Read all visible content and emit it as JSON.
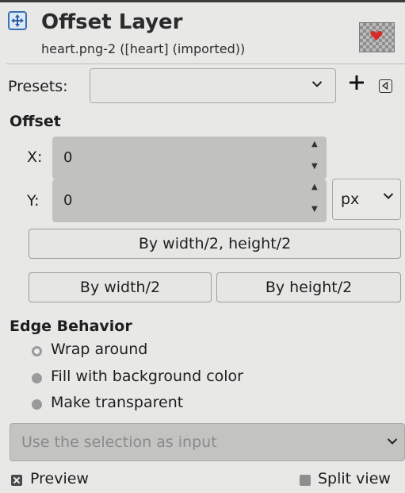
{
  "header": {
    "title": "Offset Layer",
    "subtitle": "heart.png-2 ([heart] (imported))",
    "icon": "move-icon",
    "thumbnail_icon": "heart-icon",
    "accent": "#d42a2a"
  },
  "presets": {
    "label": "Presets:",
    "value": "",
    "add_icon": "plus-icon",
    "menu_icon": "menu-icon"
  },
  "offset": {
    "heading": "Offset",
    "x_label": "X:",
    "x_value": "0",
    "y_label": "Y:",
    "y_value": "0",
    "unit": "px",
    "by_both_label": "By width/2, height/2",
    "by_width_label": "By width/2",
    "by_height_label": "By height/2"
  },
  "edge": {
    "heading": "Edge Behavior",
    "options": [
      {
        "label": "Wrap around",
        "selected": true
      },
      {
        "label": "Fill with background color",
        "selected": false
      },
      {
        "label": "Make transparent",
        "selected": false
      }
    ]
  },
  "selection_input": {
    "label": "Use the selection as input"
  },
  "footer": {
    "preview_label": "Preview",
    "preview_checked": true,
    "split_label": "Split view",
    "split_checked": false
  }
}
